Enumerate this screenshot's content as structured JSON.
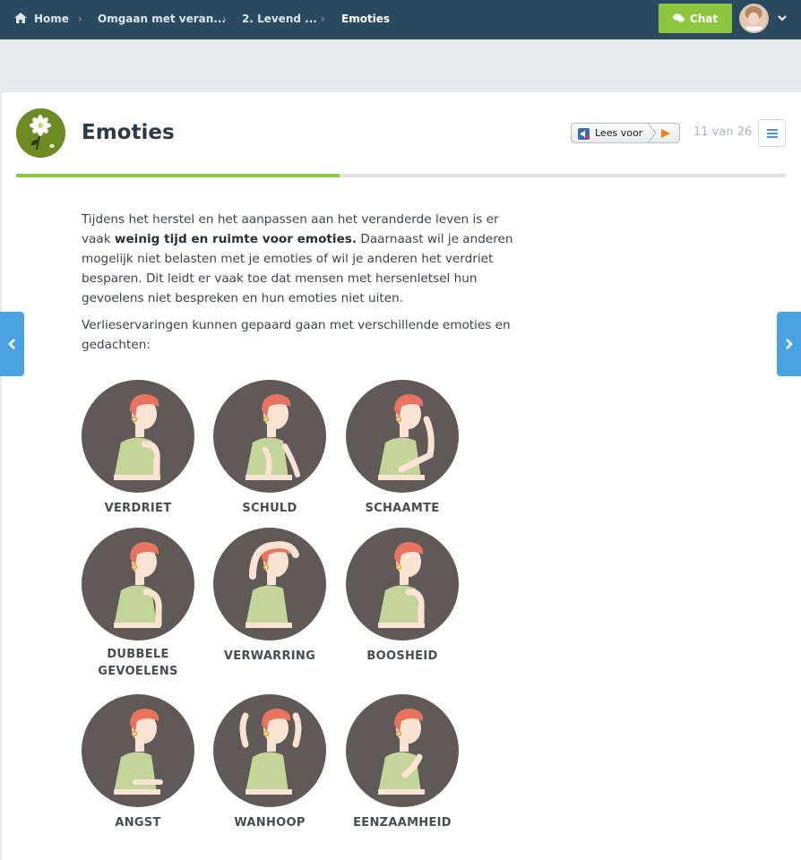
{
  "topbar": {
    "breadcrumbs": [
      {
        "label": "Home"
      },
      {
        "label": "Omgaan met veran..."
      },
      {
        "label": "2. Levend ..."
      },
      {
        "label": "Emoties"
      }
    ],
    "chat_label": "Chat"
  },
  "header": {
    "title": "Emoties",
    "read_aloud_label": "Lees voor",
    "page_counter": "11 van 26"
  },
  "progress": {
    "fraction": 0.42
  },
  "content": {
    "paragraph1_start": "Tijdens het herstel en het aanpassen aan het veranderde leven is er vaak ",
    "paragraph1_bold": "weinig tijd en ruimte voor emoties.",
    "paragraph1_end": " Daarnaast wil je anderen mogelijk niet belasten met je emoties of wil je anderen het verdriet besparen. Dit leidt er vaak toe dat mensen met hersenletsel hun gevoelens niet bespreken en hun emoties niet uiten.",
    "paragraph2": "Verlieservaringen kunnen gepaard gaan met verschillende emoties en gedachten:"
  },
  "emotions": [
    {
      "label": "VERDRIET"
    },
    {
      "label": "SCHULD"
    },
    {
      "label": "SCHAAMTE"
    },
    {
      "label": "DUBBELE GEVOELENS"
    },
    {
      "label": "VERWARRING"
    },
    {
      "label": "BOOSHEID"
    },
    {
      "label": "ANGST"
    },
    {
      "label": "WANHOOP"
    },
    {
      "label": "EENZAAMHEID"
    }
  ],
  "colors": {
    "topbar": "#2a4a5f",
    "accent_green": "#8dc63f",
    "accent_blue": "#4aa3df",
    "circle": "#5f5a58",
    "hair": "#e8735f",
    "skin": "#fbe3d3",
    "shirt": "#c4d59a"
  },
  "icons": [
    "home-icon",
    "chat-icon",
    "chevron-down-icon",
    "flower-icon",
    "speaker-icon",
    "play-icon",
    "menu-icon",
    "chevron-left-icon",
    "chevron-right-icon"
  ]
}
